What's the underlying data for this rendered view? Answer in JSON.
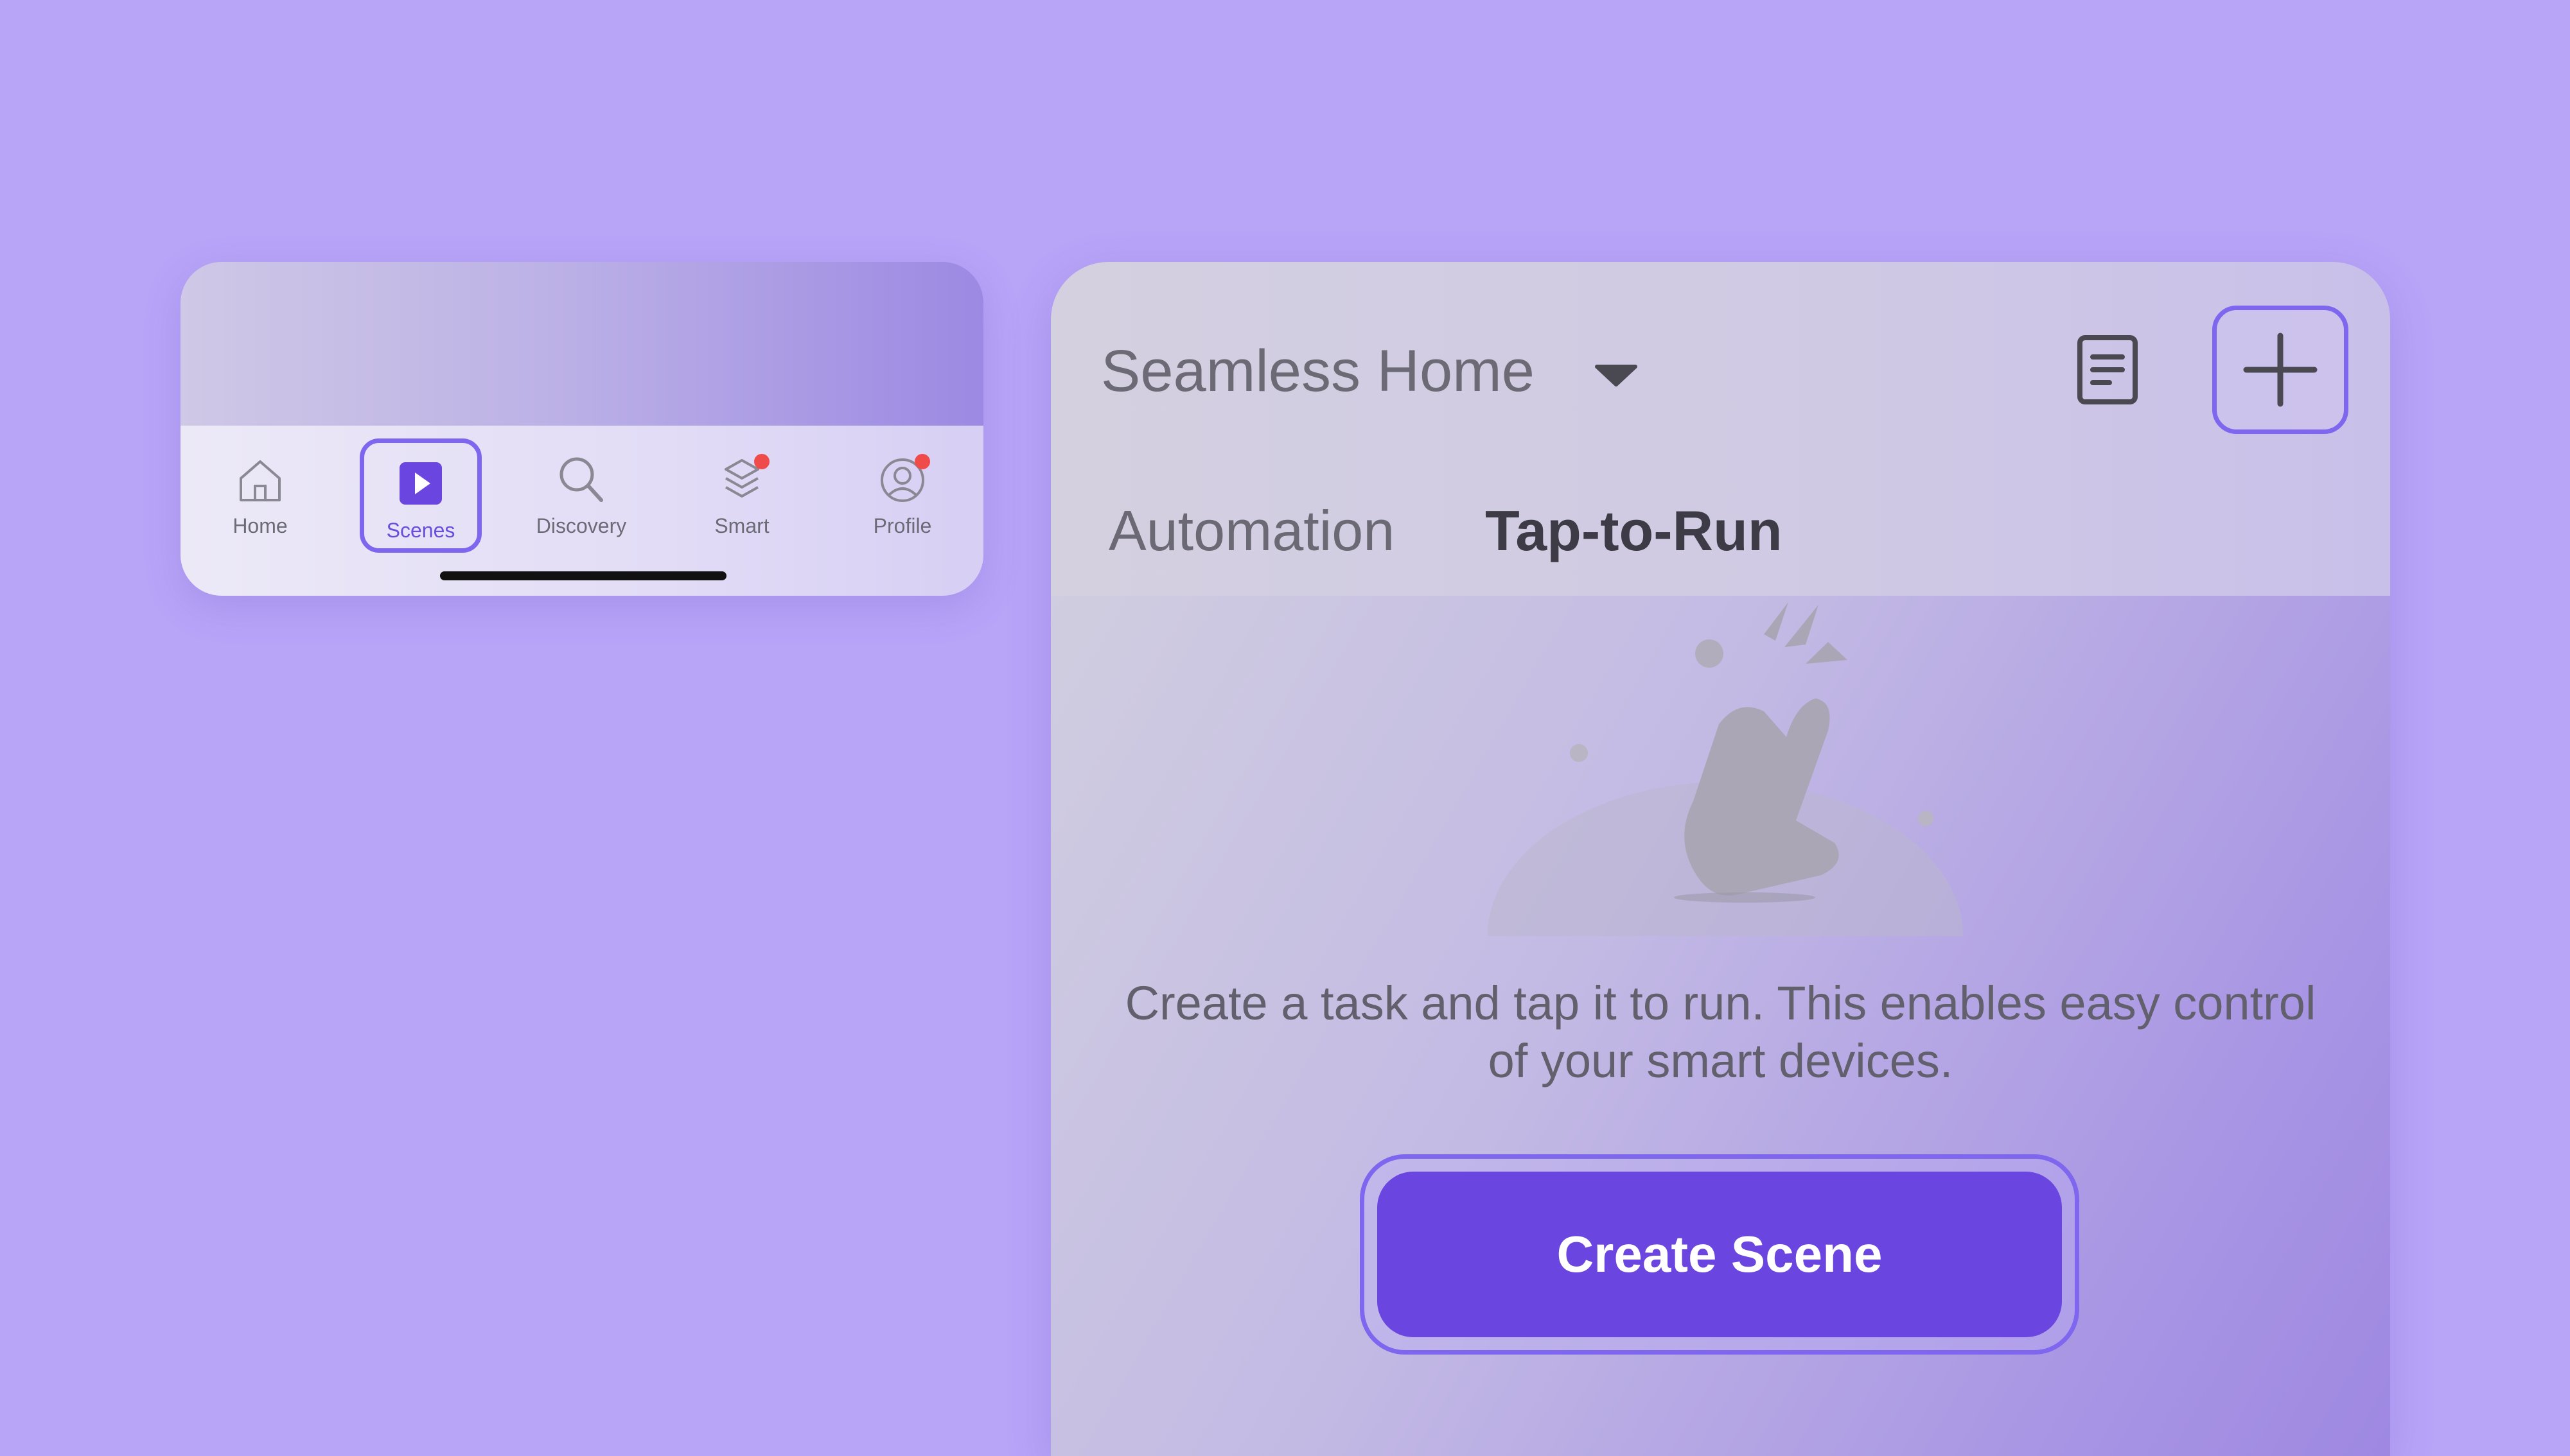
{
  "tab_bar": {
    "items": [
      {
        "label": "Home",
        "icon": "home-icon"
      },
      {
        "label": "Scenes",
        "icon": "play-icon",
        "active": true
      },
      {
        "label": "Discovery",
        "icon": "search-icon"
      },
      {
        "label": "Smart",
        "icon": "layers-icon",
        "badge": true
      },
      {
        "label": "Profile",
        "icon": "profile-icon",
        "badge": true
      }
    ]
  },
  "header": {
    "home_name": "Seamless Home",
    "tabs": [
      {
        "label": "Automation",
        "selected": false
      },
      {
        "label": "Tap-to-Run",
        "selected": true
      }
    ]
  },
  "empty_state": {
    "description": "Create a task and tap it to run. This enables easy control of your smart devices.",
    "button_label": "Create Scene"
  },
  "colors": {
    "background": "#b8a5f8",
    "accent": "#6a45df",
    "highlight": "#7f66ee",
    "badge": "#ef4b4b"
  }
}
